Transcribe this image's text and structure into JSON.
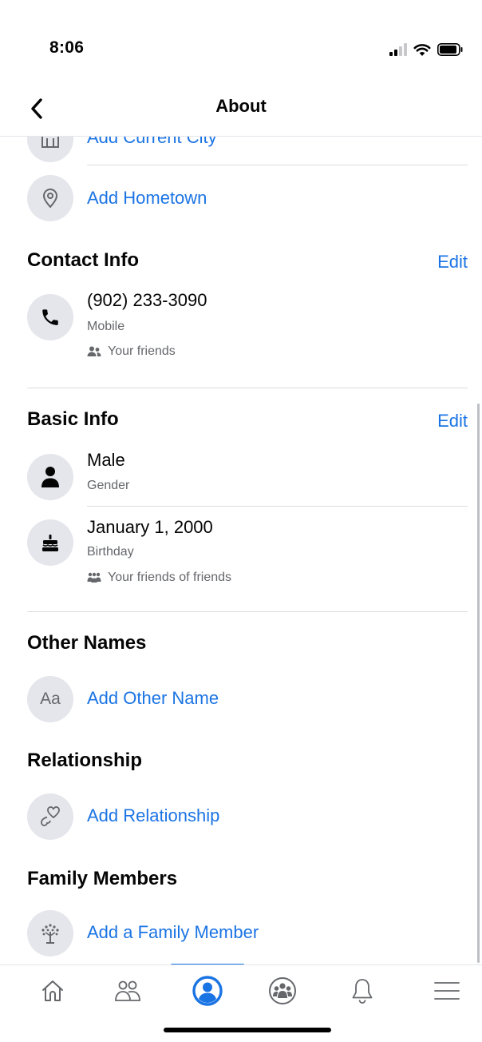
{
  "status_bar": {
    "time": "8:06"
  },
  "header": {
    "title": "About"
  },
  "places": {
    "current_city_label": "Add Current City",
    "hometown_label": "Add Hometown"
  },
  "contact_info": {
    "title": "Contact Info",
    "edit_label": "Edit",
    "phone": "(902) 233-3090",
    "phone_type": "Mobile",
    "privacy": "Your friends"
  },
  "basic_info": {
    "title": "Basic Info",
    "edit_label": "Edit",
    "gender": "Male",
    "gender_label": "Gender",
    "birthday": "January 1, 2000",
    "birthday_label": "Birthday",
    "birthday_privacy": "Your friends of friends"
  },
  "other_names": {
    "title": "Other Names",
    "add_label": "Add Other Name",
    "icon_text": "Aa"
  },
  "relationship": {
    "title": "Relationship",
    "add_label": "Add Relationship"
  },
  "family_members": {
    "title": "Family Members",
    "add_label": "Add a Family Member"
  },
  "tab_bar": {
    "tabs": [
      {
        "name": "home-icon"
      },
      {
        "name": "friends-icon"
      },
      {
        "name": "profile-icon",
        "active": true
      },
      {
        "name": "groups-icon"
      },
      {
        "name": "notifications-icon"
      },
      {
        "name": "menu-icon"
      }
    ]
  },
  "colors": {
    "accent": "#1b74e4",
    "icon_circle": "#e4e6eb",
    "secondary_text": "#65676b",
    "divider": "#dadde1"
  }
}
